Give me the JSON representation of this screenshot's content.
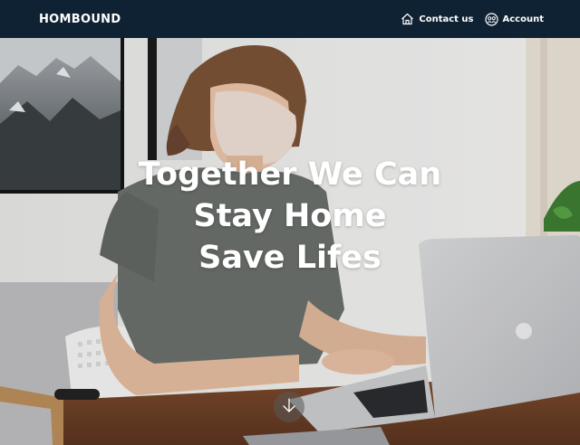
{
  "navbar": {
    "logo": "HOMBOUND",
    "links": [
      {
        "label": "Contact us",
        "icon": "home-icon"
      },
      {
        "label": "Account",
        "icon": "account-icon"
      }
    ],
    "background": "#0f2233"
  },
  "hero": {
    "title_lines": [
      "Together We Can",
      "Stay Home",
      "Save Lifes"
    ],
    "scroll_icon": "arrow-down-icon"
  }
}
